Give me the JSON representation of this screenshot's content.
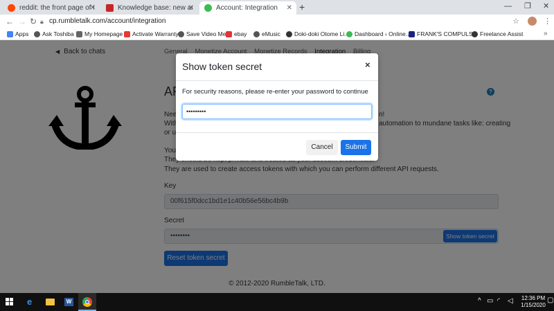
{
  "browser": {
    "tabs": [
      {
        "title": "reddit: the front page of the inte",
        "active": false,
        "color": "#ff4500"
      },
      {
        "title": "Knowledge base: new article diffi",
        "active": false,
        "color": "#c62828"
      },
      {
        "title": "Account: Integration",
        "active": true,
        "color": "#3dbb53"
      }
    ],
    "new_tab": "+",
    "window_controls": {
      "minimize": "—",
      "maximize": "❐",
      "close": "✕"
    },
    "url": "cp.rumbletalk.com/account/integration",
    "bookmarks": [
      {
        "label": "Apps",
        "color": "#4285f4"
      },
      {
        "label": "Ask Toshiba",
        "color": "#555555"
      },
      {
        "label": "My Homepage",
        "color": "#666666"
      },
      {
        "label": "Activate Warranty",
        "color": "#e53935"
      },
      {
        "label": "Save Video Me",
        "color": "#555555"
      },
      {
        "label": "ebay",
        "color": "#e53238"
      },
      {
        "label": "eMusic",
        "color": "#555555"
      },
      {
        "label": "Doki-doki Otome Li...",
        "color": "#333333"
      },
      {
        "label": "Dashboard ‹ Online...",
        "color": "#3dbb53"
      },
      {
        "label": "FRANK'S COMPULS...",
        "color": "#1a237e"
      },
      {
        "label": "Freelance Assist",
        "color": "#333333"
      }
    ]
  },
  "page": {
    "back_link": "Back to chats",
    "nav_tabs": [
      "General",
      "Monetize Account",
      "Monetize Records",
      "Integration",
      "Billing"
    ],
    "current_tab": "Integration",
    "title": "AF",
    "help": "?",
    "para1_line1": "Nee",
    "para1_line2": "With",
    "para1_line3": "or up",
    "para1_right1": "n!",
    "para1_right2": "automation to mundane tasks like: creating",
    "para2_line1": "Your",
    "para2_line2": "They should be kept private and treated as your account credentials.",
    "para2_line3": "They are used to create access tokens with which you can perform different API requests.",
    "key_label": "Key",
    "key_value": "00f615f0dcc1bd1e1c40b56e56bc4b9b",
    "secret_label": "Secret",
    "secret_value": "••••••••",
    "show_secret_button": "Show token secret",
    "reset_button": "Reset token secret",
    "footer": "© 2012-2020 RumbleTalk, LTD."
  },
  "modal": {
    "title": "Show token secret",
    "close": "×",
    "message": "For security reasons, please re-enter your password to continue",
    "password_value": "•••••••••",
    "cancel": "Cancel",
    "submit": "Submit"
  },
  "taskbar": {
    "time": "12:36 PM",
    "date": "1/15/2020"
  }
}
